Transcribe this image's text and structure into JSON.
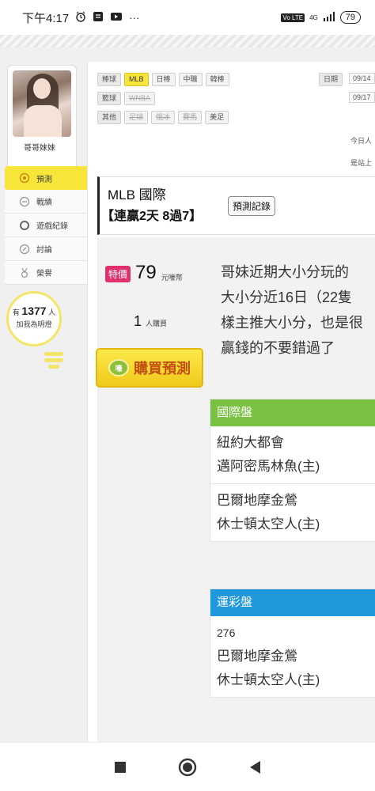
{
  "status": {
    "time": "下午4:17",
    "icons": [
      "alarm-icon",
      "notes-icon",
      "video-icon"
    ],
    "more": "···",
    "network": "4G",
    "volte": "Vo LTE",
    "battery": "79"
  },
  "profile": {
    "nickname": "哥哥妹妹"
  },
  "menu": [
    {
      "label": "預測",
      "icon": "target-icon",
      "active": true
    },
    {
      "label": "戰績",
      "icon": "record-icon",
      "active": false
    },
    {
      "label": "遊戲紀錄",
      "icon": "circle-icon",
      "active": false
    },
    {
      "label": "討論",
      "icon": "chat-icon",
      "active": false
    },
    {
      "label": "榮譽",
      "icon": "medal-icon",
      "active": false
    }
  ],
  "fans": {
    "prefix": "有",
    "count": "1377",
    "suffix": "人",
    "caption": "加我為明燈"
  },
  "filters": {
    "row1": [
      "棒球",
      "MLB",
      "日棒",
      "中職",
      "韓棒"
    ],
    "row2": [
      "籃球",
      "WNBA"
    ],
    "row3": [
      "其他",
      "足球",
      "俄冰",
      "賽馬",
      "美足"
    ],
    "date_label": "日期",
    "date_from": "09/14",
    "date_to": "09/17",
    "info1": "今日人",
    "info2": "是站上"
  },
  "prediction": {
    "league": "MLB 國際",
    "streak": "【連贏2天 8過7】",
    "history_button": "預測記錄",
    "special_badge": "特價",
    "price": "79",
    "price_unit": "元嚎幣",
    "buyers_count": "1",
    "buyers_unit": "人購買",
    "buy_button": "購買預測",
    "coin_text": "嚎",
    "description": [
      "哥妹近期大小分玩的",
      "大小分近16日（22隻",
      "樣主推大小分，也是很",
      "贏錢的不要錯過了"
    ]
  },
  "cards": [
    {
      "title": "國際盤",
      "color": "#7ac142",
      "sections": [
        {
          "lines": [
            "紐約大都會",
            "邁阿密馬林魚(主)"
          ]
        },
        {
          "lines": [
            "巴爾地摩金鶯",
            "休士頓太空人(主)"
          ]
        }
      ]
    },
    {
      "title": "運彩盤",
      "color": "#1f98dc",
      "code": "276",
      "sections": [
        {
          "lines": [
            "巴爾地摩金鶯",
            "休士頓太空人(主)"
          ]
        }
      ]
    }
  ],
  "navbar": [
    "stop-icon",
    "home-icon",
    "back-icon"
  ]
}
